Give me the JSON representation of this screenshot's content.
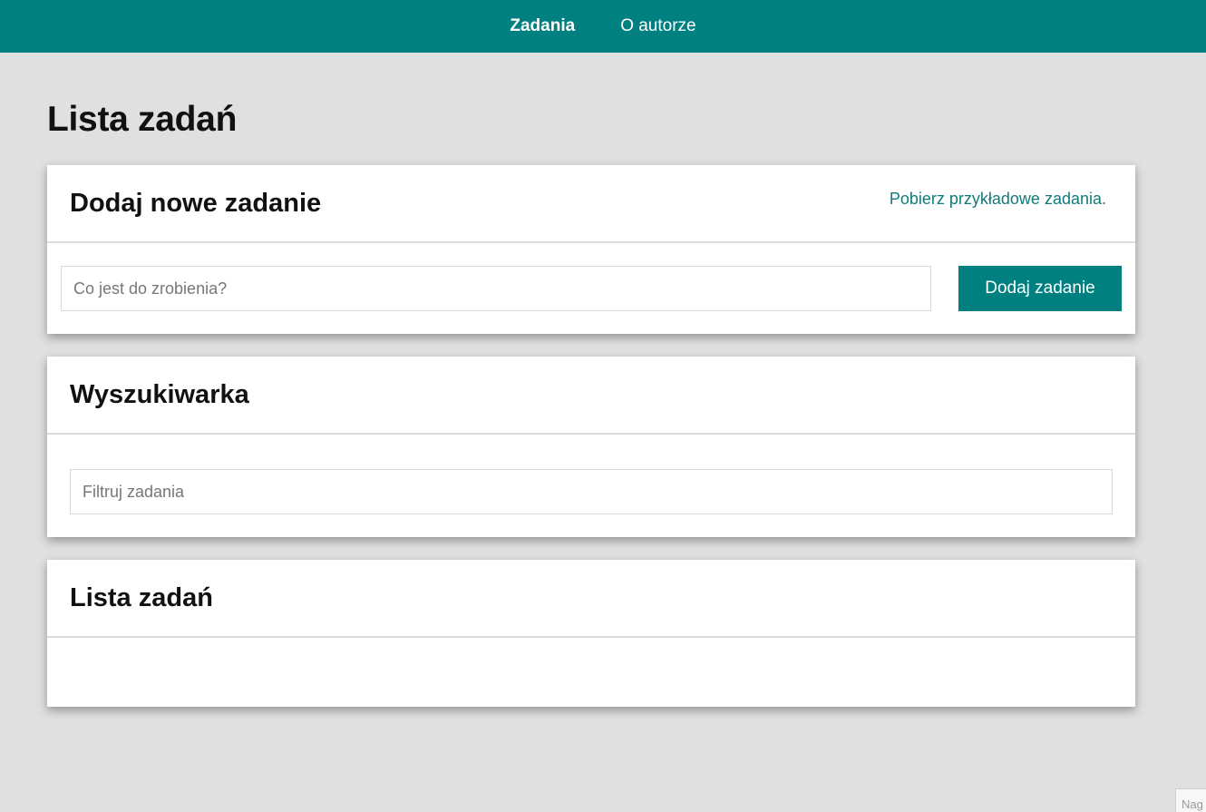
{
  "nav": {
    "items": [
      {
        "label": "Zadania",
        "active": true
      },
      {
        "label": "O autorze",
        "active": false
      }
    ],
    "background": "#008080"
  },
  "page": {
    "title": "Lista zadań"
  },
  "add_card": {
    "title": "Dodaj nowe zadanie",
    "sample_link": "Pobierz przykładowe zadania.",
    "input_placeholder": "Co jest do zrobienia?",
    "input_value": "",
    "button_label": "Dodaj zadanie"
  },
  "search_card": {
    "title": "Wyszukiwarka",
    "input_placeholder": "Filtruj zadania",
    "input_value": ""
  },
  "list_card": {
    "title": "Lista zadań",
    "items": []
  },
  "corner_tab": {
    "label": "Nag"
  },
  "colors": {
    "accent": "#008080",
    "link": "#117a7a",
    "page_bg": "#e0e0e0"
  }
}
